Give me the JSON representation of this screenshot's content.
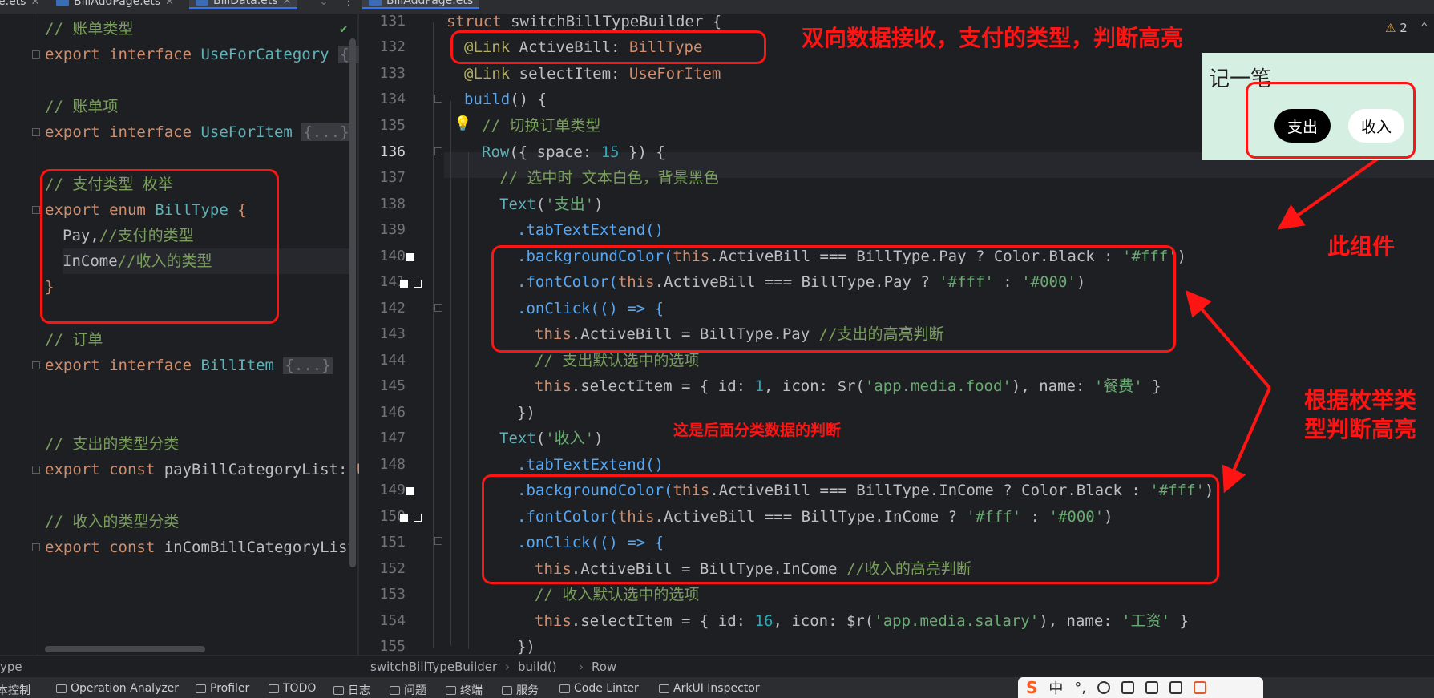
{
  "tabs": [
    {
      "label": "e.ets"
    },
    {
      "label": "BillAddPage.ets"
    },
    {
      "label": "BillData.ets"
    },
    {
      "label": "BillAddPage.ets"
    }
  ],
  "left_code": {
    "l1": "// 账单类型",
    "l2_kw": "export interface ",
    "l2_name": "UseForCategory",
    "l2_fold": "{...",
    "l3": "// 账单项",
    "l4_kw": "export interface ",
    "l4_name": "UseForItem",
    "l4_fold": "{...}",
    "l5": "// 支付类型 枚举",
    "l6_kw": "export enum ",
    "l6_name": "BillType",
    "l6_brace": " {",
    "l7_name": "Pay,",
    "l7_cm": "//支付的类型",
    "l8_name": "InCome",
    "l8_cm": "//收入的类型",
    "l9": "}",
    "l10": "// 订单",
    "l11_kw": "export interface ",
    "l11_name": "BillItem",
    "l11_fold": "{...}",
    "l12": "// 支出的类型分类",
    "l13_kw": "export const ",
    "l13_name": "payBillCategoryList: ",
    "l13_tail": "Us",
    "l14": "// 收入的类型分类",
    "l15_kw": "export const ",
    "l15_name": "inComBillCategoryList:"
  },
  "line_numbers": [
    "131",
    "132",
    "133",
    "134",
    "135",
    "136",
    "137",
    "138",
    "139",
    "140",
    "141",
    "142",
    "143",
    "144",
    "145",
    "146",
    "147",
    "148",
    "149",
    "150",
    "151",
    "152",
    "153",
    "154",
    "155"
  ],
  "code": {
    "c131_kw": "struct ",
    "c131_name": "switchBillTypeBuilder {",
    "c132_an": "@Link ",
    "c132_var": "ActiveBill: ",
    "c132_ty": "BillType",
    "c133_an": "@Link ",
    "c133_var": "selectItem: ",
    "c133_ty": "UseForItem",
    "c134_fn": "build",
    "c134_rest": "() {",
    "c135_cm": "// 切换订单类型",
    "c136_a": "Row",
    "c136_b": "({ space: ",
    "c136_num": "15",
    "c136_c": " }) {",
    "c137_cm": "// 选中时 文本白色，背景黑色",
    "c138_a": "Text",
    "c138_b": "(",
    "c138_str": "'支出'",
    "c138_c": ")",
    "c139": ".tabTextExtend()",
    "c140_a": ".backgroundColor(",
    "c140_this": "this",
    "c140_b": ".ActiveBill === BillType.Pay ? Color.Black : ",
    "c140_str": "'#fff'",
    "c140_c": ")",
    "c141_a": ".fontColor(",
    "c141_this": "this",
    "c141_b": ".ActiveBill === BillType.Pay ? ",
    "c141_s1": "'#fff'",
    "c141_m": " : ",
    "c141_s2": "'#000'",
    "c141_c": ")",
    "c142": ".onClick(() => {",
    "c143_this": "this",
    "c143_b": ".ActiveBill = BillType.Pay ",
    "c143_cm": "//支出的高亮判断",
    "c144_cm": "// 支出默认选中的选项",
    "c145_this": "this",
    "c145_b": ".selectItem = { id: ",
    "c145_num": "1",
    "c145_c": ", icon: $r(",
    "c145_str": "'app.media.food'",
    "c145_d": "), name: ",
    "c145_str2": "'餐费'",
    "c145_e": " }",
    "c146": "})",
    "c147_a": "Text",
    "c147_b": "(",
    "c147_str": "'收入'",
    "c147_c": ")",
    "c148": ".tabTextExtend()",
    "c149_a": ".backgroundColor(",
    "c149_this": "this",
    "c149_b": ".ActiveBill === BillType.InCome ? Color.Black : ",
    "c149_str": "'#fff'",
    "c149_c": ")",
    "c150_a": ".fontColor(",
    "c150_this": "this",
    "c150_b": ".ActiveBill === BillType.InCome ? ",
    "c150_s1": "'#fff'",
    "c150_m": " : ",
    "c150_s2": "'#000'",
    "c150_c": ")",
    "c151": ".onClick(() => {",
    "c152_this": "this",
    "c152_b": ".ActiveBill = BillType.InCome ",
    "c152_cm": "//收入的高亮判断",
    "c153_cm": "// 收入默认选中的选项",
    "c154_this": "this",
    "c154_b": ".selectItem = { id: ",
    "c154_num": "16",
    "c154_c": ", icon: $r(",
    "c154_str": "'app.media.salary'",
    "c154_d": "), name: ",
    "c154_str2": "'工资'",
    "c154_e": " }",
    "c155": "})"
  },
  "annotations": {
    "top": "双向数据接收，支付的类型，判断高亮",
    "component": "此组件",
    "enum_line1": "根据枚举类",
    "enum_line2": "型判断高亮",
    "later": "这是后面分类数据的判断"
  },
  "preview": {
    "title": "记一笔",
    "pay_button": "支出",
    "income_button": "收入"
  },
  "warning": {
    "count": "2"
  },
  "breadcrumb": {
    "left": "ype",
    "items": [
      "switchBillTypeBuilder",
      "build()",
      "Row"
    ]
  },
  "bottom_toolbar": [
    {
      "label": "本控制"
    },
    {
      "label": "Operation Analyzer"
    },
    {
      "label": "Profiler"
    },
    {
      "label": "TODO"
    },
    {
      "label": "日志"
    },
    {
      "label": "问题"
    },
    {
      "label": "终端"
    },
    {
      "label": "服务"
    },
    {
      "label": "Code Linter"
    },
    {
      "label": "ArkUI Inspector"
    }
  ],
  "ime": {
    "logo": "S",
    "lang": "中"
  },
  "colors": {
    "annotation": "#ff1414",
    "preview_bg": "#d5f0e2"
  }
}
